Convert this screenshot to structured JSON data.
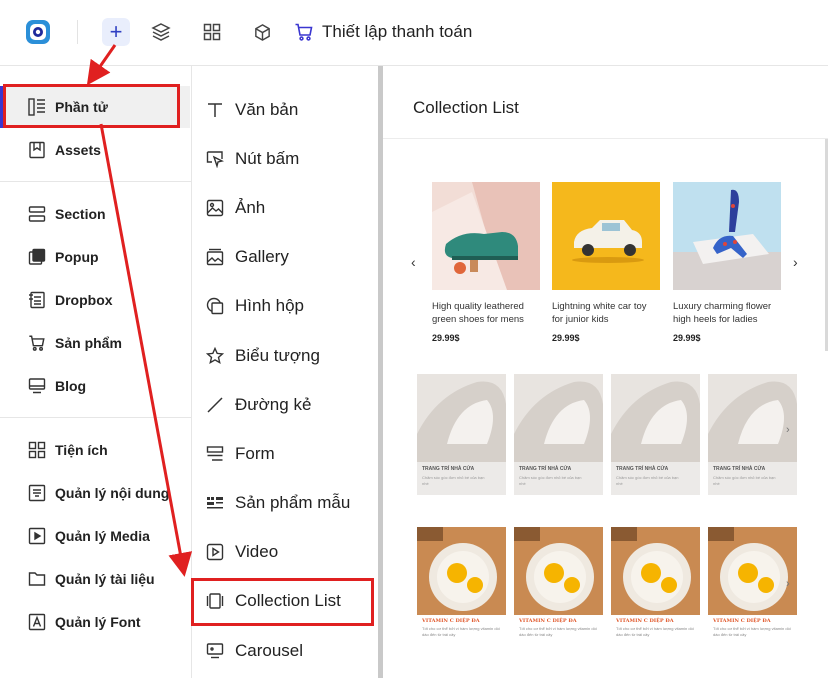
{
  "topbar": {
    "logo_icon": "app-logo-icon",
    "add_icon": "plus-icon",
    "layers_icon": "layers-icon",
    "grid_icon": "grid-icon",
    "box_icon": "cube-icon",
    "cart_icon": "cart-icon",
    "checkout_label": "Thiết lập thanh toán"
  },
  "sidebar": {
    "items": [
      {
        "label": "Phần tử",
        "icon": "elements-icon",
        "active": true
      },
      {
        "label": "Assets",
        "icon": "bookmark-icon"
      },
      {
        "label": "Section",
        "icon": "section-icon"
      },
      {
        "label": "Popup",
        "icon": "popup-icon"
      },
      {
        "label": "Dropbox",
        "icon": "dropbox-icon"
      },
      {
        "label": "Sản phẩm",
        "icon": "cart-icon"
      },
      {
        "label": "Blog",
        "icon": "monitor-icon"
      },
      {
        "label": "Tiện ích",
        "icon": "widgets-icon"
      },
      {
        "label": "Quản lý nội dung",
        "icon": "content-icon"
      },
      {
        "label": "Quản lý Media",
        "icon": "media-icon"
      },
      {
        "label": "Quản lý tài liệu",
        "icon": "folder-icon"
      },
      {
        "label": "Quản lý Font",
        "icon": "font-icon"
      }
    ]
  },
  "elements": {
    "items": [
      {
        "label": "Văn bản",
        "icon": "text-icon"
      },
      {
        "label": "Nút bấm",
        "icon": "cursor-icon"
      },
      {
        "label": "Ảnh",
        "icon": "image-icon"
      },
      {
        "label": "Gallery",
        "icon": "gallery-icon"
      },
      {
        "label": "Hình hộp",
        "icon": "shape-icon"
      },
      {
        "label": "Biểu tượng",
        "icon": "star-icon"
      },
      {
        "label": "Đường kẻ",
        "icon": "line-icon"
      },
      {
        "label": "Form",
        "icon": "form-icon"
      },
      {
        "label": "Sản phẩm mẫu",
        "icon": "product-sample-icon"
      },
      {
        "label": "Video",
        "icon": "video-icon"
      },
      {
        "label": "Collection List",
        "icon": "collection-icon",
        "highlighted": true
      },
      {
        "label": "Carousel",
        "icon": "carousel-icon"
      }
    ]
  },
  "preview": {
    "title": "Collection List",
    "row1": [
      {
        "title": "High quality leathered green shoes for mens",
        "price": "29.99$"
      },
      {
        "title": "Lightning white car toy for junior kids",
        "price": "29.99$"
      },
      {
        "title": "Luxury charming flower high heels for ladies",
        "price": "29.99$"
      }
    ],
    "row2": [
      {
        "title": "TRANG TRÍ NHÀ CỬA",
        "desc": "Chăm sóc góc đơn nhỏ bé của bạn nhé"
      },
      {
        "title": "TRANG TRÍ NHÀ CỬA",
        "desc": "Chăm sóc góc đơn nhỏ bé của bạn nhé"
      },
      {
        "title": "TRANG TRÍ NHÀ CỬA",
        "desc": "Chăm sóc góc đơn nhỏ bé của bạn nhé"
      },
      {
        "title": "TRANG TRÍ NHÀ CỬA",
        "desc": "Chăm sóc góc đơn nhỏ bé của bạn nhé"
      }
    ],
    "row3": [
      {
        "title": "VITAMIN C DIỆP ĐA",
        "desc": "Tốt cho cơ thể bởi vì hàm lượng vitamin dồi dào đến từ trái cây"
      },
      {
        "title": "VITAMIN C DIỆP ĐA",
        "desc": "Tốt cho cơ thể bởi vì hàm lượng vitamin dồi dào đến từ trái cây"
      },
      {
        "title": "VITAMIN C DIỆP ĐA",
        "desc": "Tốt cho cơ thể bởi vì hàm lượng vitamin dồi dào đến từ trái cây"
      },
      {
        "title": "VITAMIN C DIỆP ĐA",
        "desc": "Tốt cho cơ thể bởi vì hàm lượng vitamin dồi dào đến từ trái cây"
      }
    ],
    "prev_arrow": "‹",
    "next_arrow": "›"
  },
  "colors": {
    "accent": "#3a36d0",
    "highlight": "#e02020"
  }
}
